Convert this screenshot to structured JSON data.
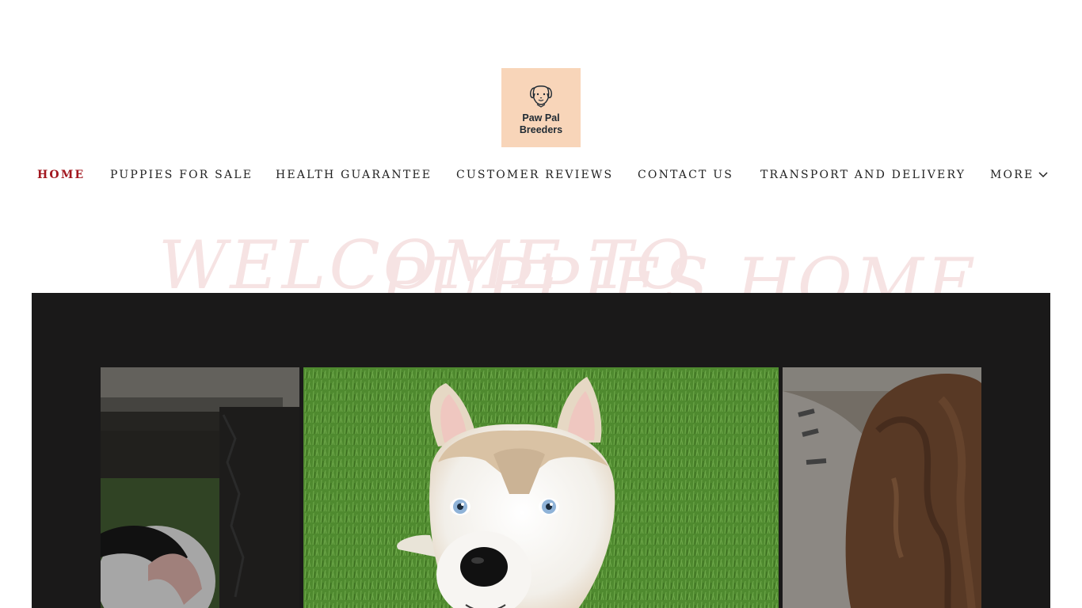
{
  "logo": {
    "line1": "Paw Pal",
    "line2": "Breeders",
    "icon": "dog-head-icon",
    "background": "#f8d5b9"
  },
  "nav": {
    "items": [
      {
        "label": "HOME",
        "active": true
      },
      {
        "label": "PUPPIES FOR SALE",
        "active": false
      },
      {
        "label": "HEALTH GUARANTEE",
        "active": false
      },
      {
        "label": "CUSTOMER REVIEWS",
        "active": false
      },
      {
        "label": "CONTACT US",
        "active": false
      },
      {
        "label": "TRANSPORT AND DELIVERY",
        "active": false
      },
      {
        "label": "MORE",
        "active": false,
        "icon": "chevron-down-icon"
      }
    ],
    "active_color": "#a2171f"
  },
  "hero": {
    "script_line1": "WELCOME TO",
    "script_line2": "PUPPIES HOME"
  },
  "gallery": {
    "background": "#1a1919",
    "slides": [
      {
        "name": "puppy-under-bench-photo"
      },
      {
        "name": "husky-puppy-on-grass-photo"
      },
      {
        "name": "brown-curly-puppy-photo"
      }
    ]
  }
}
